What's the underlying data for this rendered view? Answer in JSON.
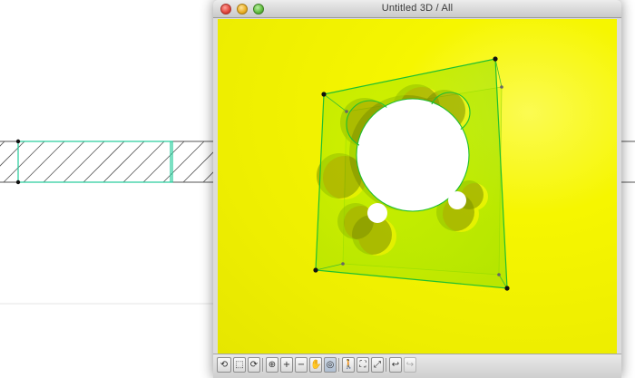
{
  "window": {
    "title": "Untitled 3D / All",
    "buttons": {
      "close": "close",
      "minimize": "minimize",
      "zoom": "zoom"
    }
  },
  "colors": {
    "viewport_background": "#f2f200",
    "wall_outline": "#22cc99",
    "hatch": "#555555",
    "glass_fill": "#9ae200",
    "edge_green": "#1fbf2f",
    "hole_fill": "#ffffff",
    "hole_shadow": "#6f7d00",
    "vertex": "#111111"
  },
  "toolbar": {
    "tools": [
      {
        "name": "orbit-tool",
        "icon": "orbit-icon",
        "glyph": "⟲",
        "state": "normal"
      },
      {
        "name": "select-view-tool",
        "icon": "select-view-icon",
        "glyph": "⬚",
        "state": "normal"
      },
      {
        "name": "rotate-tool",
        "icon": "rotate-icon",
        "glyph": "⟳",
        "state": "normal"
      },
      {
        "name": "zoom-tool",
        "icon": "zoom-icon",
        "glyph": "⊕",
        "state": "normal"
      },
      {
        "name": "zoom-in-tool",
        "icon": "zoom-in-icon",
        "glyph": "+",
        "state": "normal"
      },
      {
        "name": "zoom-out-tool",
        "icon": "zoom-out-icon",
        "glyph": "−",
        "state": "normal"
      },
      {
        "name": "pan-tool",
        "icon": "hand-icon",
        "glyph": "✋",
        "state": "normal"
      },
      {
        "name": "navigator-tool",
        "icon": "navigator-icon",
        "glyph": "◎",
        "state": "selected"
      },
      {
        "name": "walk-tool",
        "icon": "walk-icon",
        "glyph": "🚶",
        "state": "normal"
      },
      {
        "name": "explore-tool",
        "icon": "explore-icon",
        "glyph": "⛶",
        "state": "normal"
      },
      {
        "name": "fit-in-window-tool",
        "icon": "fit-window-icon",
        "glyph": "⤢",
        "state": "normal"
      },
      {
        "name": "previous-zoom-tool",
        "icon": "previous-zoom-icon",
        "glyph": "↩",
        "state": "normal"
      },
      {
        "name": "next-zoom-tool",
        "icon": "next-zoom-icon",
        "glyph": "↪",
        "state": "disabled"
      }
    ]
  }
}
